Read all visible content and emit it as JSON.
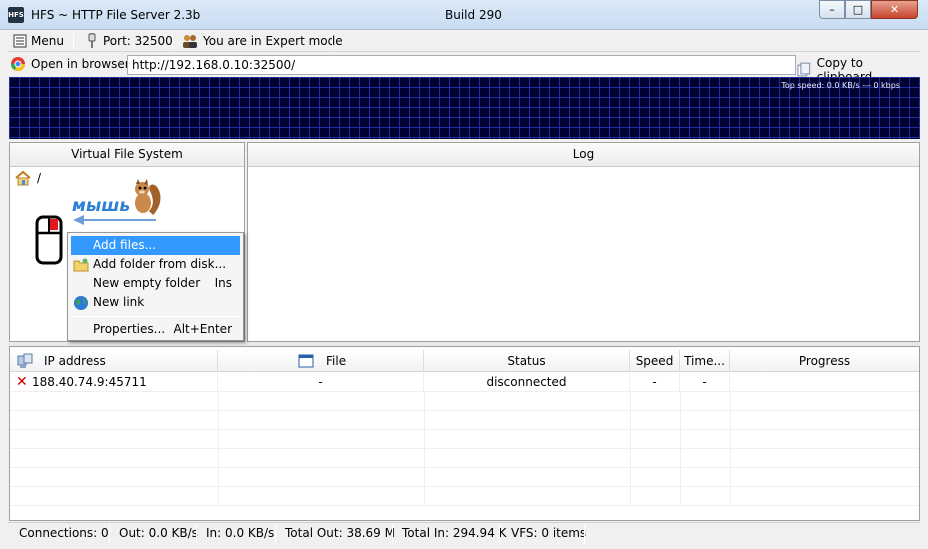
{
  "window": {
    "title": "HFS ~ HTTP File Server 2.3b",
    "build": "Build 290",
    "icon_text": "HFS"
  },
  "toolbar": {
    "menu": "Menu",
    "port": "Port: 32500",
    "mode": "You are in Expert mode"
  },
  "urlbar": {
    "open_label": "Open in browser",
    "url": "http://192.168.0.10:32500/",
    "copy_label": "Copy to clipboard"
  },
  "graph": {
    "top_speed": "Top speed: 0.0 KB/s    ---    0 kbps"
  },
  "vfs": {
    "header": "Virtual File System",
    "root": "/",
    "annotation": "мышь"
  },
  "log": {
    "header": "Log"
  },
  "context_menu": {
    "items": [
      {
        "label": "Add files...",
        "shortcut": ""
      },
      {
        "label": "Add folder from disk...",
        "shortcut": ""
      },
      {
        "label": "New empty folder",
        "shortcut": "Ins"
      },
      {
        "label": "New link",
        "shortcut": ""
      },
      {
        "label": "Properties...",
        "shortcut": "Alt+Enter"
      }
    ]
  },
  "connections": {
    "columns": [
      "IP address",
      "File",
      "Status",
      "Speed",
      "Time...",
      "Progress"
    ],
    "rows": [
      {
        "ip": "188.40.74.9:45711",
        "file": "-",
        "status": "disconnected",
        "speed": "-",
        "time": "-",
        "progress": ""
      }
    ]
  },
  "statusbar": {
    "connections": "Connections: 0",
    "out": "Out: 0.0 KB/s",
    "in": "In: 0.0 KB/s",
    "total_out": "Total Out: 38.69 M",
    "total_in": "Total In: 294.94 K",
    "vfs": "VFS: 0 items"
  },
  "colors": {
    "graph_bg": "#020230",
    "grid": "#283cbe",
    "highlight": "#3399ff",
    "annotation": "#2f7fd6",
    "error": "#cc0000"
  }
}
